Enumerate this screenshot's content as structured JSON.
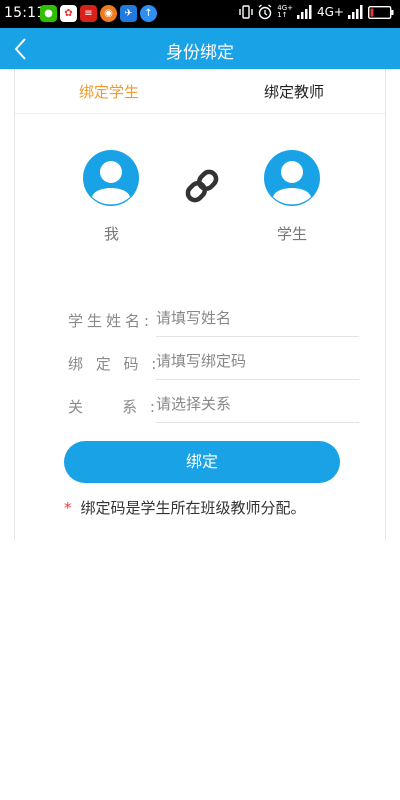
{
  "status_bar": {
    "time": "15:11",
    "network_label": "4G+",
    "small_network_label": "4G+",
    "small_network_sub": "1↑",
    "app_icons": [
      "wechat-icon",
      "photos-icon",
      "news-icon",
      "weibo-icon",
      "sports-icon",
      "upload-icon"
    ]
  },
  "header": {
    "title": "身份绑定"
  },
  "tabs": [
    {
      "label": "绑定学生",
      "active": true
    },
    {
      "label": "绑定教师",
      "active": false
    }
  ],
  "avatars": {
    "me_label": "我",
    "student_label": "学生"
  },
  "form": {
    "student_name_label": "学生姓名:",
    "student_name_placeholder": "请填写姓名",
    "bind_code_label": "绑 定 码 :",
    "bind_code_placeholder": "请填写绑定码",
    "relation_label": "关    系 :",
    "relation_placeholder": "请选择关系"
  },
  "bind_button_label": "绑定",
  "note": {
    "star": "*",
    "text": "绑定码是学生所在班级教师分配。"
  },
  "colors": {
    "primary": "#1aa2e6",
    "active_tab": "#f39a2b",
    "star": "#e43d3d"
  }
}
